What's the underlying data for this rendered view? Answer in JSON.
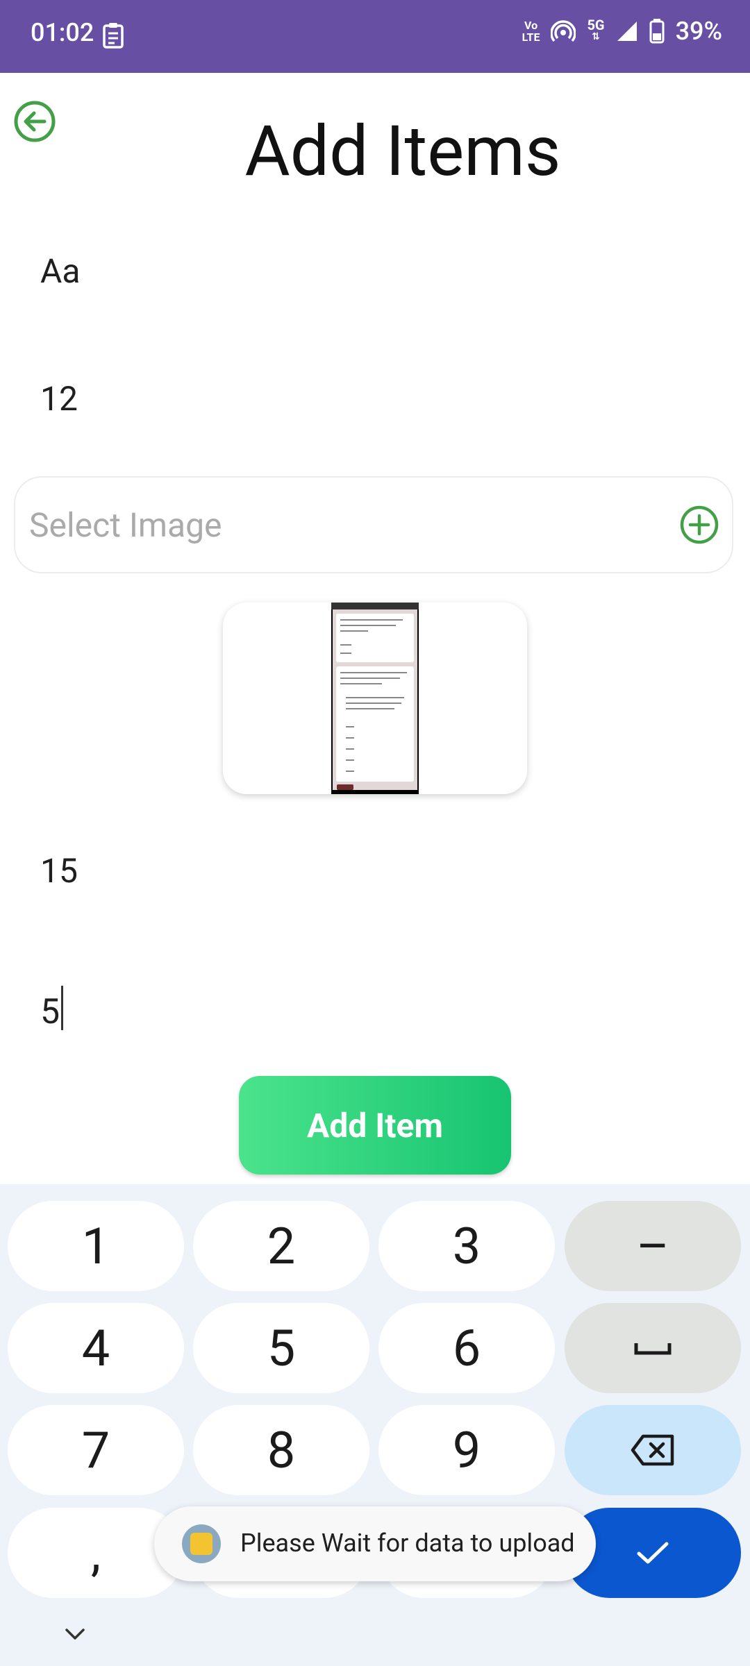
{
  "status_bar": {
    "time": "01:02",
    "volte_line1": "Vo",
    "volte_line2": "LTE",
    "network": "5G",
    "battery": "39%"
  },
  "header": {
    "title": "Add Items"
  },
  "form": {
    "name_value": "Aa",
    "price_value": "12",
    "select_image_placeholder": "Select Image",
    "stock_value": "15",
    "quantity_value": "5",
    "submit_label": "Add Item"
  },
  "keyboard": {
    "keys": [
      "1",
      "2",
      "3",
      "–",
      "4",
      "5",
      "6",
      "␣",
      "7",
      "8",
      "9",
      "⌫",
      ",",
      "✓"
    ]
  },
  "toast": {
    "message": "Please Wait for data to upload"
  }
}
